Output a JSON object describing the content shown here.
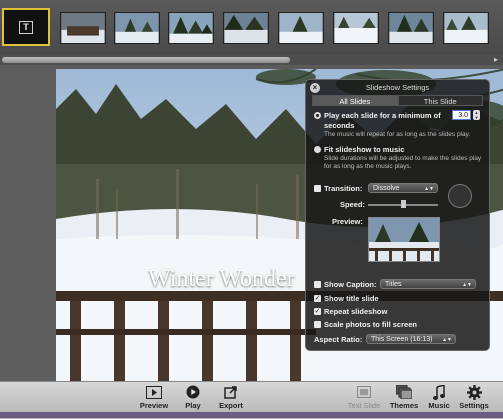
{
  "filmstrip": {
    "title_slide_glyph": "T"
  },
  "photo": {
    "caption": "Winter Wonder"
  },
  "hud": {
    "title": "Slideshow Settings",
    "close_glyph": "×",
    "tabs": [
      "All Slides",
      "This Slide"
    ],
    "play_each_label": "Play each slide for a minimum of",
    "play_each_unit": "seconds",
    "duration_value": "3.0",
    "play_each_sub": "The music will repeat for as long as the slides play.",
    "fit_music_label": "Fit slideshow to music",
    "fit_music_sub": "Slide durations will be adjusted to make the slides play for as long as the music plays.",
    "transition_label": "Transition:",
    "transition_value": "Dissolve",
    "speed_label": "Speed:",
    "preview_label": "Preview:",
    "show_caption_label": "Show Caption:",
    "caption_value": "Titles",
    "show_title_label": "Show title slide",
    "repeat_label": "Repeat slideshow",
    "scale_label": "Scale photos to fill screen",
    "aspect_label": "Aspect Ratio:",
    "aspect_value": "This Screen (16:13)",
    "show_title_checked": true,
    "repeat_checked": true,
    "scale_checked": false,
    "transition_checked": false,
    "show_caption_checked": false
  },
  "toolbar": {
    "preview": "Preview",
    "play": "Play",
    "export": "Export",
    "text_slide": "Text Slide",
    "themes": "Themes",
    "music": "Music",
    "settings": "Settings"
  },
  "icons": [
    "title-slide-icon",
    "preview-icon",
    "play-icon",
    "export-icon",
    "text-slide-icon",
    "themes-icon",
    "music-icon",
    "settings-gear-icon"
  ],
  "colors": {
    "selection_border": "#e0c23a",
    "hud_bg": "#181818",
    "toolbar_bg": "#c8c8c8"
  }
}
